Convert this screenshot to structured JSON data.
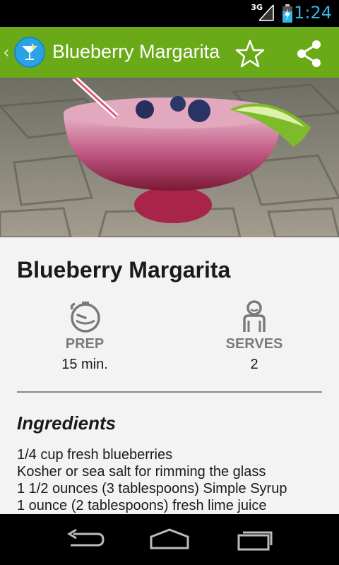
{
  "status_bar": {
    "network": "3G",
    "time": "1:24"
  },
  "action_bar": {
    "title": "Blueberry Margarita",
    "icons": {
      "up": "chevron-left-icon",
      "app": "cocktail-glass-icon",
      "favorite": "star-outline-icon",
      "share": "share-icon"
    }
  },
  "hero": {
    "subject": "blueberry margarita in glass on brick patio"
  },
  "recipe": {
    "title": "Blueberry Margarita",
    "prep": {
      "label": "PREP",
      "value": "15 min."
    },
    "serves": {
      "label": "SERVES",
      "value": "2"
    },
    "ingredients_heading": "Ingredients",
    "ingredients": [
      "1/4 cup fresh blueberries",
      "Kosher or sea salt for rimming the glass",
      "1 1/2 ounces (3 tablespoons) Simple Syrup",
      "1 ounce (2 tablespoons) fresh lime juice"
    ]
  },
  "nav_bar": {
    "icons": [
      "back-icon",
      "home-icon",
      "recent-apps-icon"
    ]
  },
  "colors": {
    "action_bar": "#6aaa18",
    "clock": "#33b5e5",
    "app_icon": "#29a3e6"
  }
}
